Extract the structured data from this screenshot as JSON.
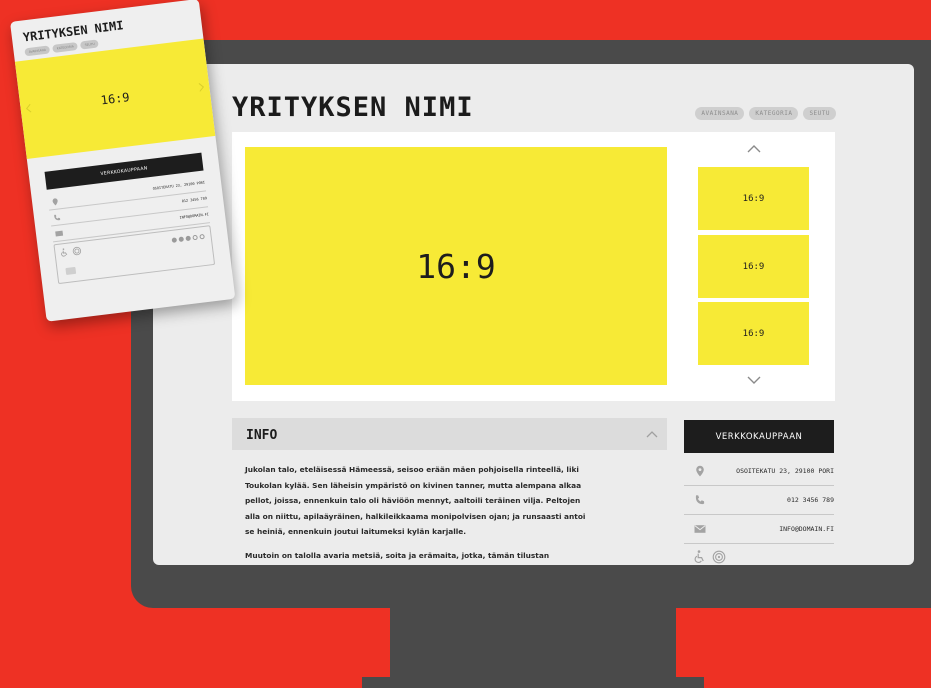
{
  "colors": {
    "background": "#ee3124",
    "monitor": "#4a4a4a",
    "screen": "#ececec",
    "placeholder": "#f7ea36",
    "dark_button": "#1d1d1d",
    "tag": "#cfcfcf"
  },
  "desktop": {
    "company_name": "YRITYKSEN NIMI",
    "tags": [
      "AVAINSANA",
      "KATEGORIA",
      "SEUTU"
    ],
    "gallery": {
      "main_label": "16:9",
      "thumbnails": [
        "16:9",
        "16:9",
        "16:9"
      ],
      "up_icon": "chevron-up-icon",
      "down_icon": "chevron-down-icon"
    },
    "info": {
      "title": "INFO",
      "paragraphs": [
        "Jukolan talo, eteläisessä Hämeessä, seisoo erään mäen pohjoisella rinteellä, liki Toukolan kylää. Sen läheisin ympäristö on kivinen tanner, mutta alempana alkaa pellot, joissa, ennenkuin talo oli häviöön mennyt, aaltoili teräinen vilja. Peltojen alla on niittu, apilaäyräinen, halkileikkaama monipolvisen ojan; ja runsaasti antoi se heiniä, ennenkuin joutui laitumeksi kylän karjalle.",
        "Muutoin on talolla avaria metsiä, soita ja erämaita, jotka, tämän tilustan"
      ]
    },
    "shop_button": "VERKKOKAUPPAAN",
    "contact": {
      "address": "OSOITEKATU 23, 29100 PORI",
      "phone": "012 3456 789",
      "email": "INFO@DOMAIN.FI"
    },
    "accessibility_icons": [
      "wheelchair-icon",
      "hearing-loop-icon"
    ]
  },
  "mobile": {
    "company_name": "YRITYKSEN NIMI",
    "tags": [
      "AVAINSANA",
      "KATEGORIA",
      "SEUTU"
    ],
    "slide_label": "16:9",
    "shop_button": "VERKKOKAUPPAAN",
    "contact": {
      "address": "OSOITEKATU 23, 29100 PORI",
      "phone": "012 3456 789",
      "email": "INFO@DOMAIN.FI"
    },
    "pager": {
      "total": 5,
      "active": [
        0,
        1,
        2
      ]
    }
  }
}
